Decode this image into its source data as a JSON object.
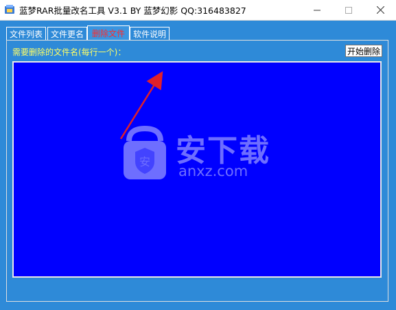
{
  "window": {
    "title": "蓝梦RAR批量改名工具 V3.1 BY 蓝梦幻影 QQ:316483827",
    "icon": "app-icon",
    "controls": [
      "minimize-icon",
      "maximize-icon",
      "close-icon"
    ]
  },
  "tabs": [
    {
      "label": "文件列表",
      "active": false
    },
    {
      "label": "文件更名",
      "active": false
    },
    {
      "label": "删除文件",
      "active": true
    },
    {
      "label": "软件说明",
      "active": false
    }
  ],
  "panel": {
    "label": "需要删除的文件名(每行一个)：",
    "start_button": "开始删除",
    "textarea_value": ""
  },
  "watermark": {
    "text": "安下载",
    "subtext": "anxz.com"
  },
  "colors": {
    "background": "#2e8ad8",
    "textarea": "#0000ff",
    "label": "#ffff66",
    "active_tab": "#ff2a2a",
    "arrow": "#e0202a"
  }
}
